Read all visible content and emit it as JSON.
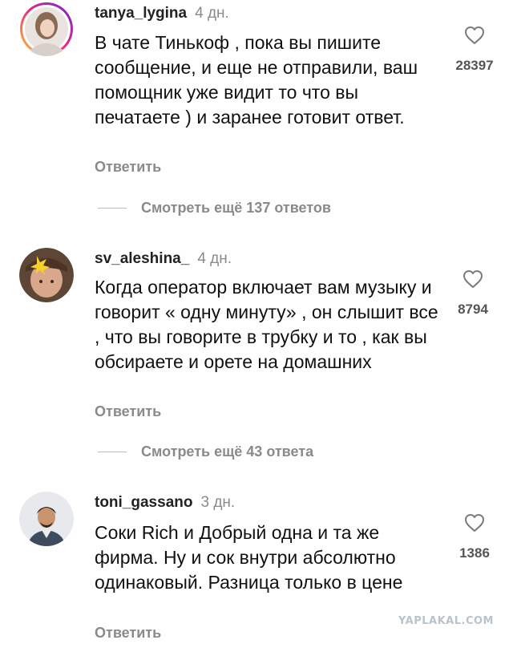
{
  "comments": [
    {
      "username": "tanya_lygina",
      "age": "4 дн.",
      "text": "В чате Тинькоф , пока вы пишите сообщение, и еще не отправили, ваш помощник уже видит то что вы печатаете ) и заранее готовит ответ.",
      "likes": "28397",
      "reply_label": "Ответить",
      "more_replies": "Смотреть ещё 137 ответов"
    },
    {
      "username": "sv_aleshina_",
      "age": "4 дн.",
      "text": "Когда оператор включает вам музыку и говорит « одну минуту» , он слышит все , что вы говорите в трубку и то , как вы обсираете и орете на домашних",
      "likes": "8794",
      "reply_label": "Ответить",
      "more_replies": "Смотреть ещё 43 ответа"
    },
    {
      "username": "toni_gassano",
      "age": "3 дн.",
      "text": "Соки Rich и Добрый одна и та же фирма. Ну и сок внутри абсолютно одинаковый. Разница только в цене",
      "likes": "1386",
      "reply_label": "Ответить"
    }
  ],
  "watermark": "YAPLAKAL.COM",
  "colors": {
    "story_ring_start": "#f9ce34",
    "story_ring_mid": "#ee2a7b",
    "story_ring_end": "#6228d7",
    "secondary_text": "#8a8a8a"
  }
}
